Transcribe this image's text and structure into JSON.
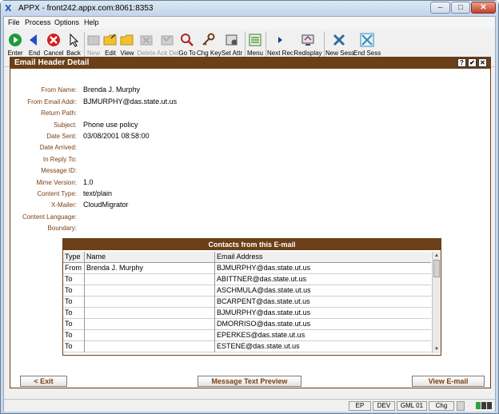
{
  "window": {
    "title": "APPX - front242.appx.com:8061:8353",
    "app_icon": "X",
    "minimize": "–",
    "maximize": "□",
    "close": "✕"
  },
  "menu": [
    "File",
    "Process",
    "Options",
    "Help"
  ],
  "toolbar": [
    {
      "label": "Enter",
      "icon": "play-icon",
      "enabled": true
    },
    {
      "label": "End",
      "icon": "back-arrow-icon",
      "enabled": true
    },
    {
      "label": "Cancel",
      "icon": "cancel-icon",
      "enabled": true
    },
    {
      "label": "Back",
      "icon": "back-cursor-icon",
      "enabled": true
    },
    {
      "label": "New",
      "icon": "new-icon",
      "enabled": false
    },
    {
      "label": "Edit",
      "icon": "folder-edit-icon",
      "enabled": true
    },
    {
      "label": "View",
      "icon": "folder-view-icon",
      "enabled": true
    },
    {
      "label": "Delete",
      "icon": "delete-icon",
      "enabled": false
    },
    {
      "label": "Ack Del",
      "icon": "ack-delete-icon",
      "enabled": false
    },
    {
      "label": "Go To",
      "icon": "magnifier-icon",
      "enabled": true
    },
    {
      "label": "Chg Key",
      "icon": "key-icon",
      "enabled": true
    },
    {
      "label": "Set Attr",
      "icon": "set-attr-icon",
      "enabled": true
    },
    {
      "label": "Menu",
      "icon": "menu-list-icon",
      "enabled": true
    },
    {
      "label": "Next Rec",
      "icon": "next-record-icon",
      "enabled": true
    },
    {
      "label": "Redisplay",
      "icon": "redisplay-icon",
      "enabled": true
    },
    {
      "label": "New Sess",
      "icon": "new-session-icon",
      "enabled": true
    },
    {
      "label": "End Sess",
      "icon": "end-session-icon",
      "enabled": true
    }
  ],
  "panel": {
    "title": "Email Header Detail",
    "help": "?",
    "check": "✔",
    "close": "✕"
  },
  "fields": [
    {
      "label": "From Name:",
      "value": "Brenda J. Murphy"
    },
    {
      "label": "From Email Addr:",
      "value": "BJMURPHY@das.state.ut.us"
    },
    {
      "label": "Return Path:",
      "value": ""
    },
    {
      "label": "Subject:",
      "value": "Phone use policy"
    },
    {
      "label": "Date Sent:",
      "value": "03/08/2001 08:58:00"
    },
    {
      "label": "Date Arrived:",
      "value": ""
    },
    {
      "label": "In Reply To:",
      "value": ""
    },
    {
      "label": "Message ID:",
      "value": ""
    },
    {
      "label": "Mime Version:",
      "value": "1.0"
    },
    {
      "label": "Content Type:",
      "value": "text/plain"
    },
    {
      "label": "X-Mailer:",
      "value": "CloudMigrator"
    },
    {
      "label": "Content Language:",
      "value": ""
    },
    {
      "label": "Boundary:",
      "value": ""
    }
  ],
  "contacts": {
    "title": "Contacts from this E-mail",
    "columns": [
      "Type",
      "Name",
      "Email Address"
    ],
    "rows": [
      [
        "From",
        "Brenda J. Murphy",
        "BJMURPHY@das.state.ut.us"
      ],
      [
        "To",
        "",
        "ABITTNER@das.state.ut.us"
      ],
      [
        "To",
        "",
        "ASCHMULA@das.state.ut.us"
      ],
      [
        "To",
        "",
        "BCARPENT@das.state.ut.us"
      ],
      [
        "To",
        "",
        "BJMURPHY@das.state.ut.us"
      ],
      [
        "To",
        "",
        "DMORRISO@das.state.ut.us"
      ],
      [
        "To",
        "",
        "EPERKES@das.state.ut.us"
      ],
      [
        "To",
        "",
        "ESTENE@das.state.ut.us"
      ]
    ]
  },
  "buttons": {
    "exit": "< Exit",
    "preview": "Message Text Preview",
    "view": "View E-mail"
  },
  "status": [
    "EP",
    "DEV",
    "GML 01",
    "Chg"
  ],
  "colors": {
    "header_brown": "#6b3f17",
    "label_brown": "#7a3f12"
  }
}
